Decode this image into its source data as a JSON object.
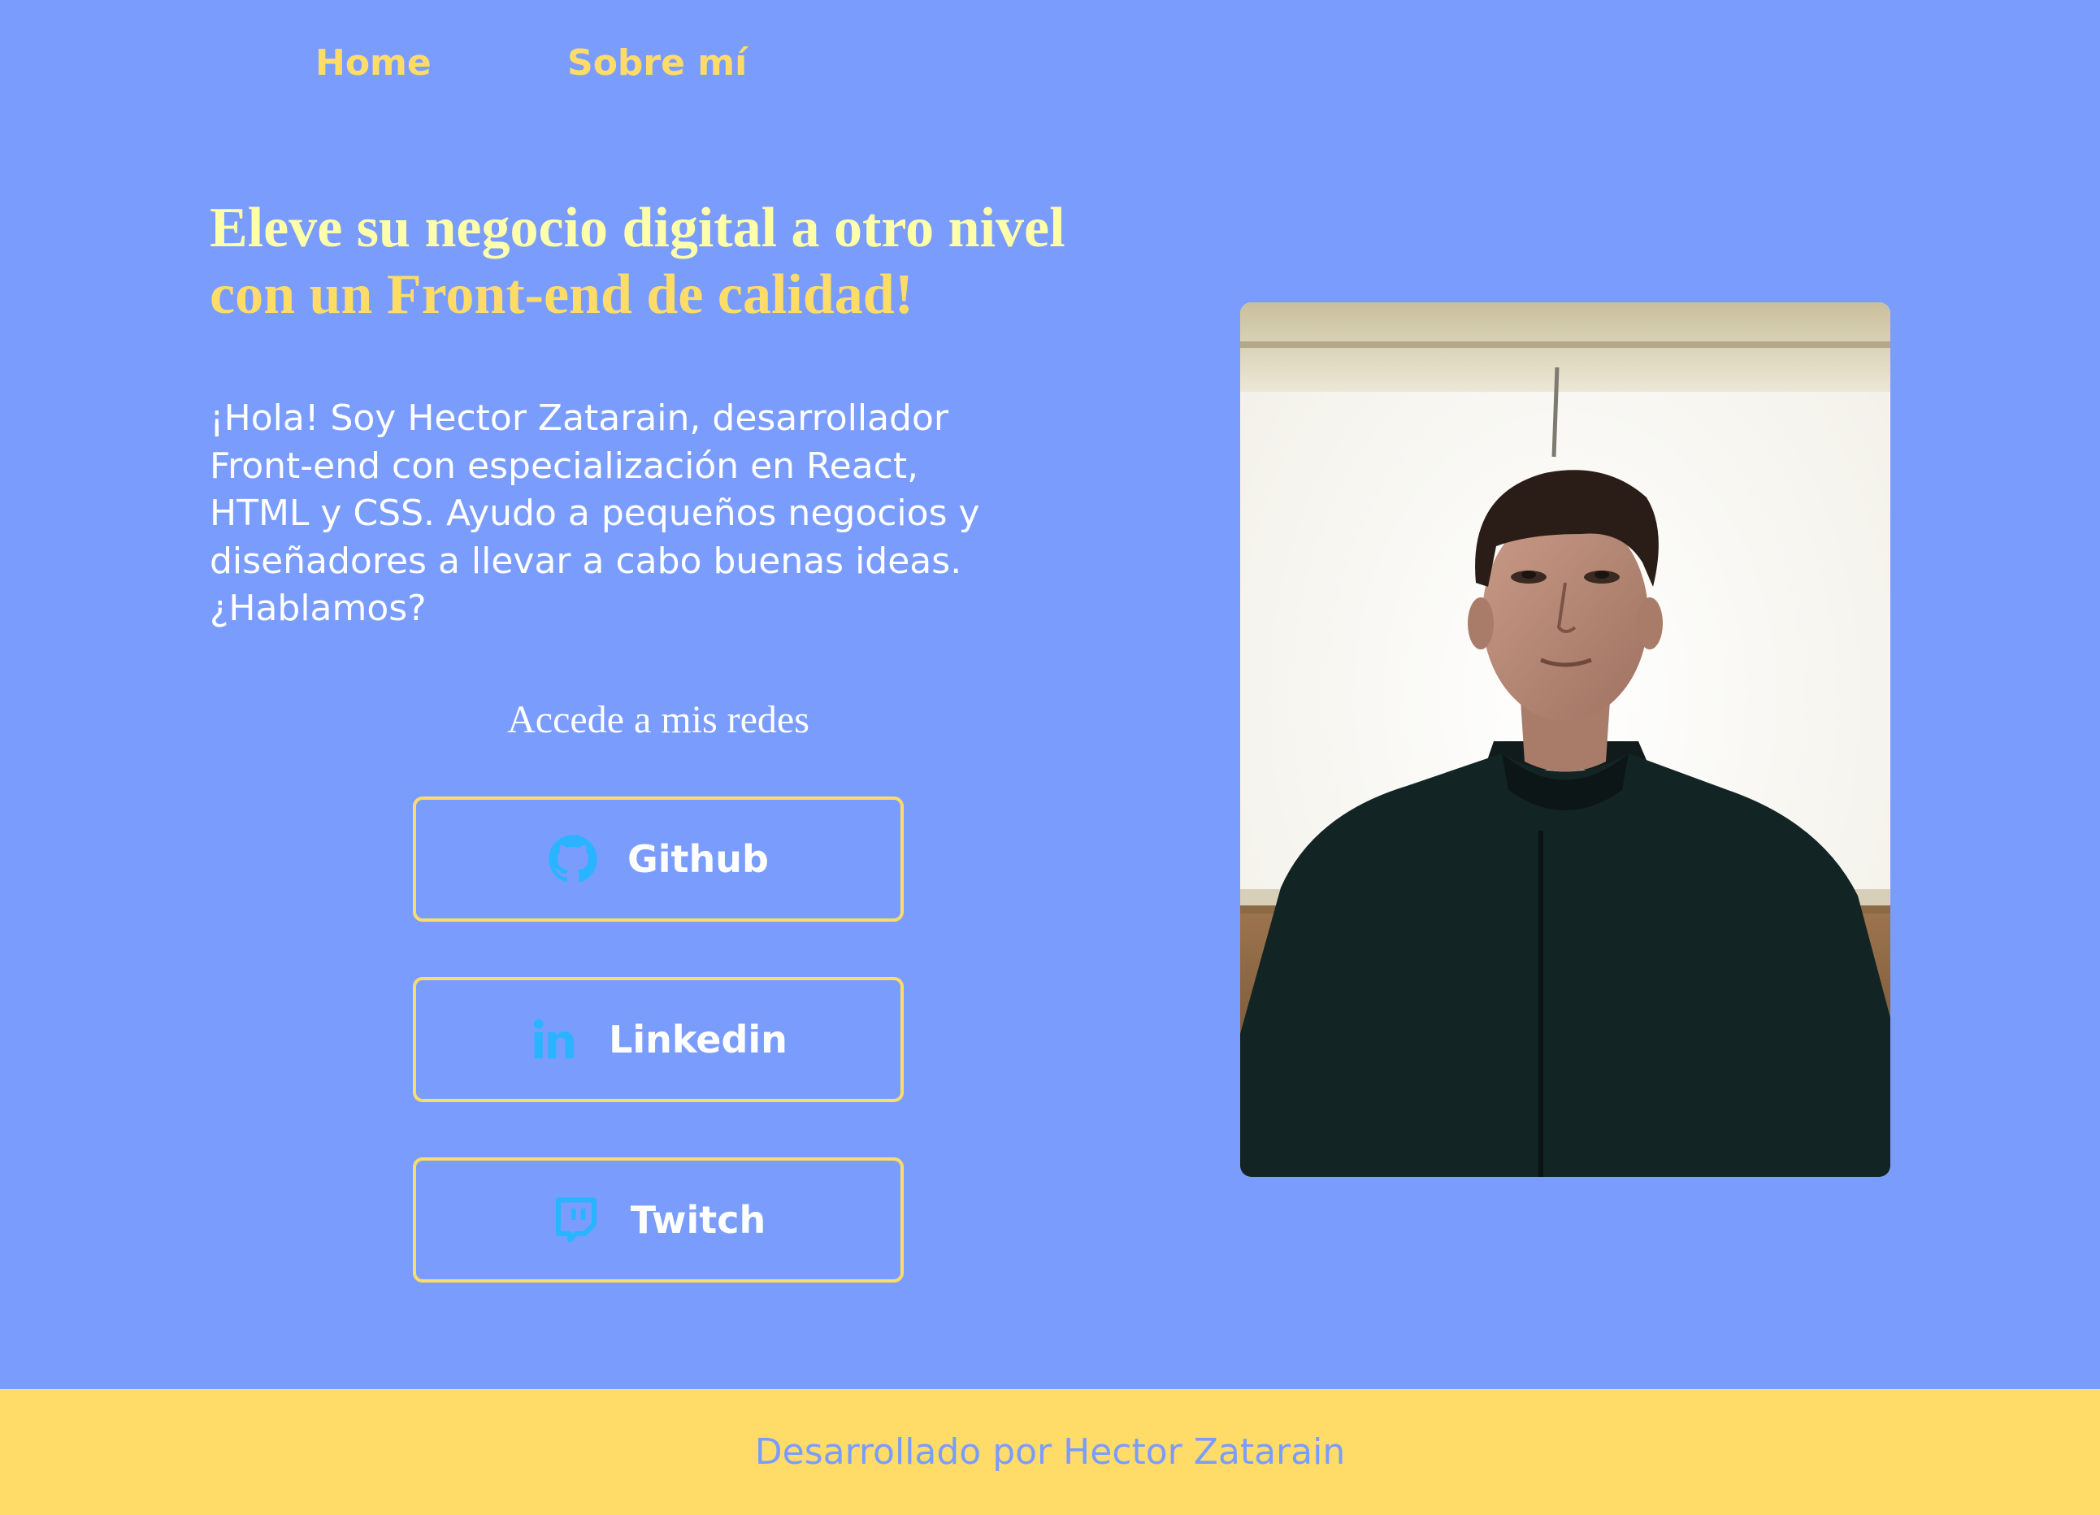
{
  "colors": {
    "background": "#7a9dfd",
    "accent": "#ffdc68",
    "headline_light": "#ffffaa",
    "text": "#ffffff",
    "icon": "#2ab4ff"
  },
  "nav": {
    "home_label": "Home",
    "about_label": "Sobre mí"
  },
  "hero": {
    "headline_line1": "Eleve su negocio digital a otro nivel",
    "headline_line2": "con un Front-end de calidad!",
    "intro_lines": [
      "¡Hola! Soy Hector Zatarain, desarrollador",
      "Front-end con especialización en React,",
      "HTML y CSS. Ayudo a pequeños negocios y",
      "diseñadores a llevar a cabo buenas ideas.",
      "¿Hablamos?"
    ]
  },
  "social": {
    "title": "Accede a mis redes",
    "buttons": [
      {
        "label": "Github",
        "icon": "github-icon"
      },
      {
        "label": "Linkedin",
        "icon": "linkedin-icon"
      },
      {
        "label": "Twitch",
        "icon": "twitch-icon"
      }
    ]
  },
  "photo": {
    "icon": "profile-photo"
  },
  "footer": {
    "text": "Desarrollado por Hector Zatarain"
  }
}
